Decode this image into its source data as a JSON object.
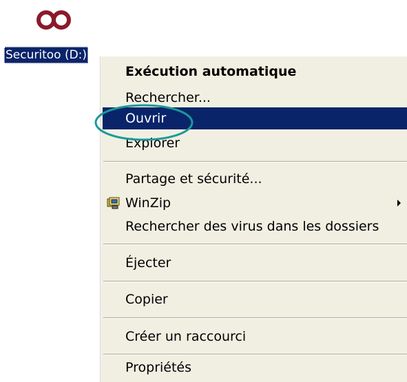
{
  "desktop": {
    "drive_icon": "infinity-logo-icon",
    "drive_label": "Securitoo (D:)",
    "accent_color": "#0a246a",
    "logo_color": "#8b1a2b",
    "annotation_color": "#1a9a9a"
  },
  "context_menu": {
    "items": [
      {
        "label": "Exécution automatique",
        "default": true
      },
      {
        "label": "Rechercher..."
      },
      {
        "label": "Ouvrir",
        "selected": true
      },
      {
        "label": "Explorer"
      },
      {
        "label": "Partage et sécurité..."
      },
      {
        "label": "WinZip",
        "icon": "winzip-icon",
        "submenu": true
      },
      {
        "label": "Rechercher des virus dans les dossiers"
      },
      {
        "label": "Éjecter"
      },
      {
        "label": "Copier"
      },
      {
        "label": "Créer un raccourci"
      },
      {
        "label": "Propriétés"
      }
    ]
  }
}
